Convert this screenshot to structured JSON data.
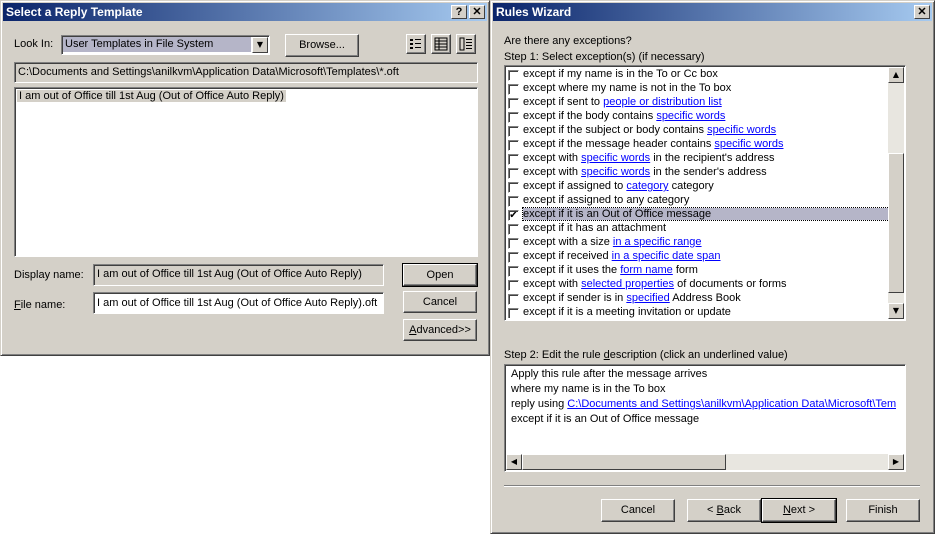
{
  "reply_dialog": {
    "title": "Select a Reply Template",
    "help_btn": "?",
    "close_btn": "✕",
    "look_in_label": "Look In:",
    "look_in_value": "User Templates in File System",
    "browse_label": "Browse...",
    "path": "C:\\Documents and Settings\\anilkvm\\Application Data\\Microsoft\\Templates\\*.oft",
    "files": [
      "I am out of Office till 1st Aug (Out of Office Auto Reply)"
    ],
    "display_name_label": "Display name:",
    "display_name_value": "I am out of Office till 1st Aug (Out of Office Auto Reply)",
    "file_name_label": "File name:",
    "file_name_value": "I am out of Office till 1st Aug (Out of Office Auto Reply).oft",
    "open_label": "Open",
    "cancel_label": "Cancel",
    "advanced_label": "Advanced>>"
  },
  "wizard": {
    "title": "Rules Wizard",
    "close_btn": "✕",
    "question": "Are there any exceptions?",
    "step1_label": "Step 1: Select exception(s) (if necessary)",
    "exceptions": [
      {
        "pre": "except if my name is in the To or Cc box",
        "link": "",
        "post": "",
        "checked": false
      },
      {
        "pre": "except where my name is not in the To box",
        "link": "",
        "post": "",
        "checked": false
      },
      {
        "pre": "except if sent to ",
        "link": "people or distribution list",
        "post": "",
        "checked": false
      },
      {
        "pre": "except if the body contains ",
        "link": "specific words",
        "post": "",
        "checked": false
      },
      {
        "pre": "except if the subject or body contains ",
        "link": "specific words",
        "post": "",
        "checked": false
      },
      {
        "pre": "except if the message header contains ",
        "link": "specific words",
        "post": "",
        "checked": false
      },
      {
        "pre": "except with ",
        "link": "specific words",
        "post": " in the recipient's address",
        "checked": false
      },
      {
        "pre": "except with ",
        "link": "specific words",
        "post": " in the sender's address",
        "checked": false
      },
      {
        "pre": "except if assigned to ",
        "link": "category",
        "post": " category",
        "checked": false
      },
      {
        "pre": "except if assigned to any category",
        "link": "",
        "post": "",
        "checked": false
      },
      {
        "pre": "except if it is an Out of Office message",
        "link": "",
        "post": "",
        "checked": true
      },
      {
        "pre": "except if it has an attachment",
        "link": "",
        "post": "",
        "checked": false
      },
      {
        "pre": "except with a size ",
        "link": "in a specific range",
        "post": "",
        "checked": false
      },
      {
        "pre": "except if received ",
        "link": "in a specific date span",
        "post": "",
        "checked": false
      },
      {
        "pre": "except if it uses the ",
        "link": "form name",
        "post": " form",
        "checked": false
      },
      {
        "pre": "except with ",
        "link": "selected properties",
        "post": " of documents or forms",
        "checked": false
      },
      {
        "pre": "except if sender is in ",
        "link": "specified",
        "post": " Address Book",
        "checked": false
      },
      {
        "pre": "except if it is a meeting invitation or update",
        "link": "",
        "post": "",
        "checked": false
      }
    ],
    "step2_label": "Step 2: Edit the rule description (click an underlined value)",
    "description": {
      "line1": "Apply this rule after the message arrives",
      "line2": "where my name is in the To box",
      "line3_pre": "reply using ",
      "line3_link": "C:\\Documents and Settings\\anilkvm\\Application Data\\Microsoft\\Templa",
      "line4": "except if it is an Out of Office message"
    },
    "cancel_label": "Cancel",
    "back_label": "< Back",
    "next_label": "Next >",
    "finish_label": "Finish"
  }
}
